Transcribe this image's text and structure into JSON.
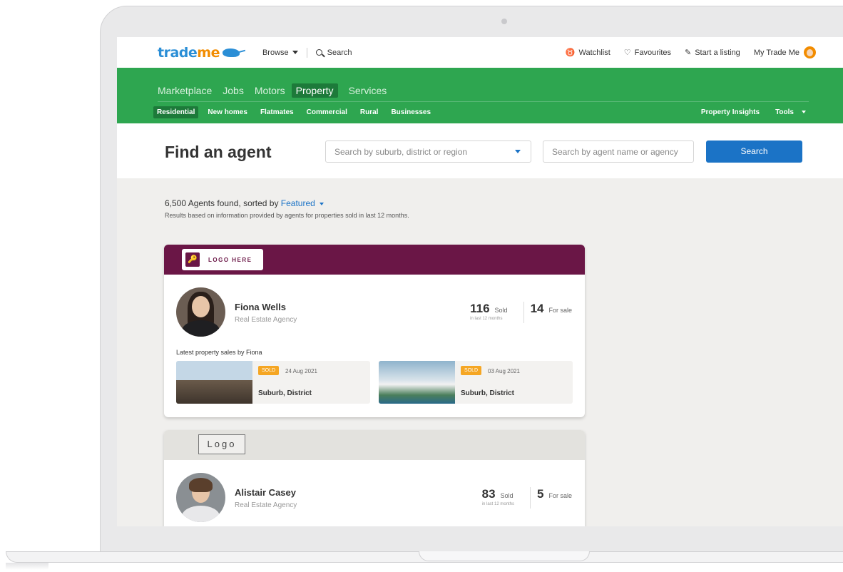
{
  "header": {
    "logo_main": "trade",
    "logo_accent": "me",
    "browse_label": "Browse",
    "search_label": "Search",
    "watchlist_label": "Watchlist",
    "favourites_label": "Favourites",
    "start_listing_label": "Start a listing",
    "my_trademe_label": "My Trade Me"
  },
  "main_nav": [
    {
      "label": "Marketplace"
    },
    {
      "label": "Jobs"
    },
    {
      "label": "Motors"
    },
    {
      "label": "Property"
    },
    {
      "label": "Services"
    }
  ],
  "sub_nav": [
    {
      "label": "Residential"
    },
    {
      "label": "New homes"
    },
    {
      "label": "Flatmates"
    },
    {
      "label": "Commercial"
    },
    {
      "label": "Rural"
    },
    {
      "label": "Businesses"
    }
  ],
  "sub_nav_right": {
    "insights_label": "Property Insights",
    "tools_label": "Tools"
  },
  "find": {
    "title": "Find an agent",
    "location_placeholder": "Search by suburb, district or region",
    "agent_placeholder": "Search by agent name or agency",
    "search_button": "Search"
  },
  "results": {
    "count_text": "6,500 Agents found, sorted by",
    "sort_label": "Featured",
    "note": "Results based on information provided by agents for properties sold in last 12 months."
  },
  "agents": [
    {
      "logo_text": "LOGO HERE",
      "name": "Fiona Wells",
      "agency": "Real Estate Agency",
      "sold": "116",
      "sold_label": "Sold",
      "sold_sub": "in last 12 months",
      "for_sale": "14",
      "for_sale_label": "For sale",
      "latest_title": "Latest property sales by Fiona",
      "sales": [
        {
          "badge": "SOLD",
          "date": "24 Aug 2021",
          "location": "Suburb, District"
        },
        {
          "badge": "SOLD",
          "date": "03 Aug 2021",
          "location": "Suburb, District"
        }
      ]
    },
    {
      "logo_text": "Logo",
      "name": "Alistair Casey",
      "agency": "Real Estate Agency",
      "sold": "83",
      "sold_label": "Sold",
      "sold_sub": "in last 12 months",
      "for_sale": "5",
      "for_sale_label": "For sale"
    }
  ],
  "colors": {
    "green_nav": "#2ea650",
    "brand_blue": "#1b73c6",
    "brand_orange": "#f28c00",
    "agency_purple": "#6a1646",
    "sold_badge": "#f5a623"
  }
}
